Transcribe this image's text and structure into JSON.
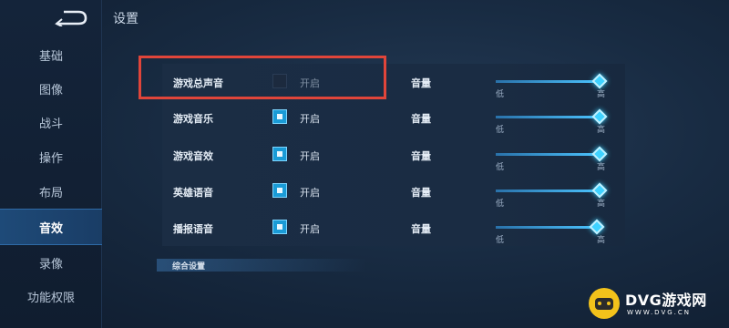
{
  "header": {
    "title": "设置"
  },
  "sidebar": {
    "items": [
      {
        "label": "基础",
        "active": false
      },
      {
        "label": "图像",
        "active": false
      },
      {
        "label": "战斗",
        "active": false
      },
      {
        "label": "操作",
        "active": false
      },
      {
        "label": "布局",
        "active": false
      },
      {
        "label": "音效",
        "active": true
      },
      {
        "label": "录像",
        "active": false
      },
      {
        "label": "功能权限",
        "active": false
      }
    ]
  },
  "audio": {
    "rows": [
      {
        "label": "游戏总声音",
        "toggle_label": "开启",
        "enabled": false,
        "volume_label": "音量",
        "low": "低",
        "high": "高",
        "level": 1.0
      },
      {
        "label": "游戏音乐",
        "toggle_label": "开启",
        "enabled": true,
        "volume_label": "音量",
        "low": "低",
        "high": "高",
        "level": 1.0
      },
      {
        "label": "游戏音效",
        "toggle_label": "开启",
        "enabled": true,
        "volume_label": "音量",
        "low": "低",
        "high": "高",
        "level": 1.0
      },
      {
        "label": "英雄语音",
        "toggle_label": "开启",
        "enabled": true,
        "volume_label": "音量",
        "low": "低",
        "high": "高",
        "level": 1.0
      },
      {
        "label": "播报语音",
        "toggle_label": "开启",
        "enabled": true,
        "volume_label": "音量",
        "low": "低",
        "high": "高",
        "level": 0.97
      }
    ],
    "section_label": "综合设置"
  },
  "watermark": {
    "text": "DVG游戏网",
    "sub": "WWW.DVG.CN"
  },
  "colors": {
    "accent": "#1a9bd6",
    "highlight": "#e0453a",
    "knob": "#3fd2ff"
  }
}
